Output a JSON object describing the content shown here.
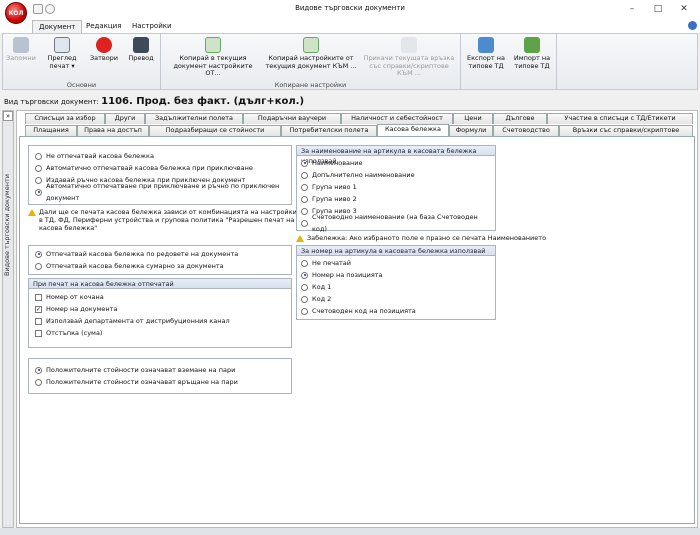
{
  "window": {
    "title": "Видове търговски документи",
    "orb_label": "КОЛ"
  },
  "ribbon_tabs": [
    "Документ",
    "Редакция",
    "Настройки"
  ],
  "groups": {
    "basic": "Основни",
    "copy": "Копиране настройки",
    "empty": ""
  },
  "buttons": {
    "save": "Запомни",
    "preview": "Преглед печат ▾",
    "close": "Затвори",
    "translate": "Превод",
    "copy_to": "Копирай в текущия документ настройките ОТ...",
    "copy_from": "Копирай настройките от текущия документ КЪМ ...",
    "attach": "Прикачи текущата връзка със справки/скриптове КЪМ ...",
    "export": "Експорт на типове ТД",
    "import": "Импорт на типове ТД"
  },
  "doc_label": "Вид търговски документ:",
  "doc_name": "1106. Прод. без факт. (дълг+кол.)",
  "side_label": "Видове търговски документи",
  "tabs_row1": [
    "Списъци за избор",
    "Други",
    "Задължителни полета",
    "Подаръчни ваучери",
    "Наличност и себестойност",
    "Цени",
    "Дългове",
    "Участие в списъци с ТД/Етикети"
  ],
  "tabs_row2": [
    "Плащания",
    "Права на достъп",
    "Подразбиращи се стойности",
    "Потребителски полета",
    "Касова бележка",
    "Формули",
    "Счетоводство",
    "Връзки със справки/скриптове"
  ],
  "receipt_options": [
    "Не отпечатвай касова бележка",
    "Автоматично отпечатвай касова бележка при приключване",
    "Издавай ръчно касова бележка при приключен документ",
    "Автоматично отпечатване при приключване и ръчно по приключен документ"
  ],
  "receipt_warning": "Дали ще се печата касова бележка зависи от комбинацията на настройки в ТД, ФД, Периферни устройства и групова политика \"Разрешен печат на касова бележка\"",
  "rows_options": [
    "Отпечатвай касова бележка по редовете на документа",
    "Отпечатвай касова бележка сумарно за документа"
  ],
  "print_group": {
    "title": "При печат на касова бележка отпечатай",
    "items": [
      "Номер от кочана",
      "Номер на документа",
      "Използвай департамента от дистрибуционния канал",
      "Отстъпка (сума)"
    ],
    "checked": [
      false,
      true,
      false,
      false
    ]
  },
  "sign_options": [
    "Положителните стойности означават вземане на пари",
    "Положителните стойности означават връщане на пари"
  ],
  "name_group": {
    "title": "За наименование на артикула в касовата бележка използвай",
    "items": [
      "Наименование",
      "Допълнително наименование",
      "Група ниво 1",
      "Група ниво 2",
      "Група ниво 3",
      "Счетоводно наименование (на база Счетоводен код)"
    ]
  },
  "name_note": "Забележка: Ако избраното поле е празно се печата Наименованието",
  "number_group": {
    "title": "За номер на артикула в касовата бележка използвай",
    "items": [
      "Не печатай",
      "Номер на позицията",
      "Код 1",
      "Код 2",
      "Счетоводен код на позицията"
    ]
  },
  "colors": {
    "accent": "#2b5797"
  }
}
